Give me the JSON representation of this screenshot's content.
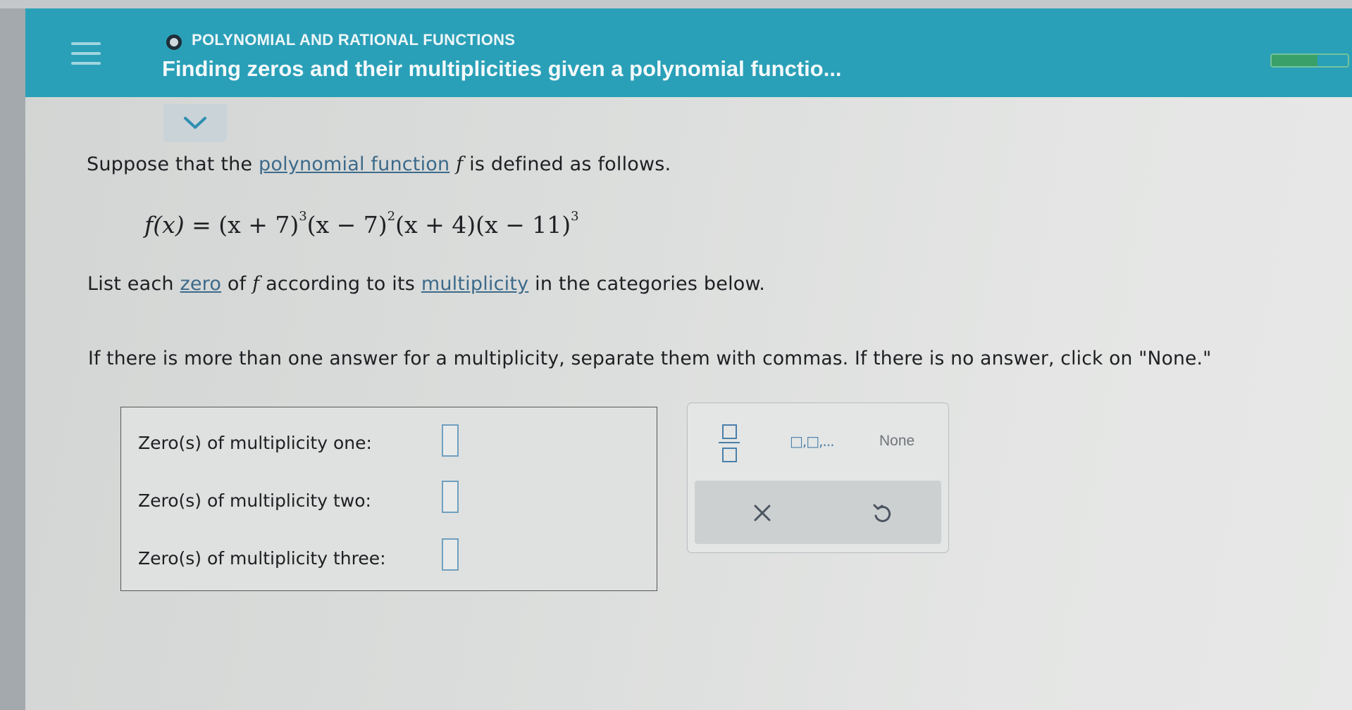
{
  "header": {
    "topic": "POLYNOMIAL AND RATIONAL FUNCTIONS",
    "title": "Finding zeros and their multiplicities given a polynomial functio...",
    "progress_fraction": 0.6
  },
  "prompt": {
    "line1_before": "Suppose that the",
    "line1_link": "polynomial function",
    "line1_var": "f",
    "line1_after": "is defined as follows.",
    "formula_lhs": "f(x) = ",
    "formula_factors": [
      {
        "base": "(x + 7)",
        "exp": "3"
      },
      {
        "base": "(x − 7)",
        "exp": "2"
      },
      {
        "base": "(x + 4)",
        "exp": ""
      },
      {
        "base": "(x − 11)",
        "exp": "3"
      }
    ],
    "line2_before": "List each",
    "line2_link1": "zero",
    "line2_mid1": "of",
    "line2_var": "f",
    "line2_mid2": "according to its",
    "line2_link2": "multiplicity",
    "line2_after": "in the categories below.",
    "instruction": "If there is more than one answer for a multiplicity, separate them with commas. If there is no answer, click on \"None.\""
  },
  "answers": {
    "rows": [
      {
        "label": "Zero(s) of multiplicity one:",
        "value": ""
      },
      {
        "label": "Zero(s) of multiplicity two:",
        "value": ""
      },
      {
        "label": "Zero(s) of multiplicity three:",
        "value": ""
      }
    ]
  },
  "keypad": {
    "list_label": "□,□,...",
    "none_label": "None",
    "icons": [
      "fraction-icon",
      "close-icon",
      "undo-icon",
      "menu-icon",
      "chevron-down-icon"
    ],
    "accent_color": "#4a7fa8"
  },
  "colors": {
    "header": "#2aa0b8",
    "link": "#3c6a8a",
    "progress_fill": "#3aa06a"
  }
}
